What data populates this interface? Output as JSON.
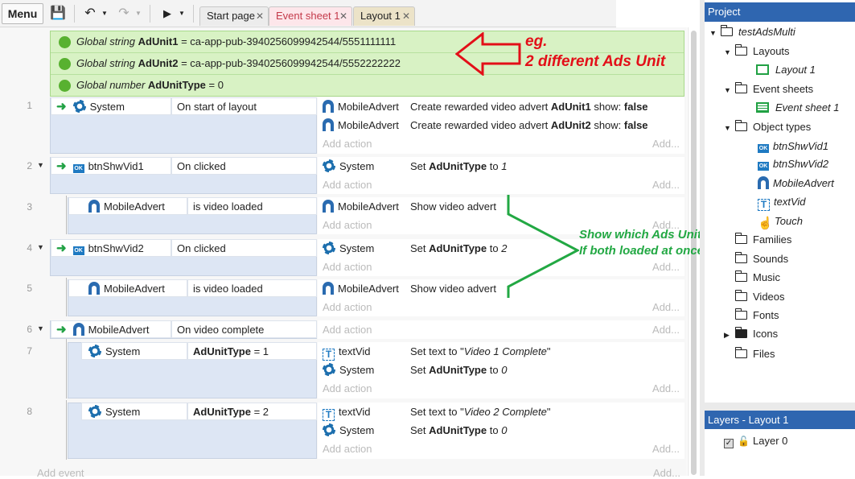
{
  "toolbar": {
    "menu": "Menu",
    "tabs": [
      "Start page",
      "Event sheet 1",
      "Layout 1"
    ]
  },
  "globals": [
    {
      "kind": "Global string",
      "name": "AdUnit1",
      "value": "= ca-app-pub-3940256099942544/5551111111"
    },
    {
      "kind": "Global string",
      "name": "AdUnit2",
      "value": "= ca-app-pub-3940256099942544/5552222222"
    },
    {
      "kind": "Global number",
      "name": "AdUnitType",
      "value": "= 0"
    }
  ],
  "events": {
    "e1": {
      "num": "1",
      "obj": "System",
      "cond": "On start of layout",
      "a1o": "MobileAdvert",
      "a1": "Create rewarded video advert ",
      "a1b": "AdUnit1",
      "a1c": " show: ",
      "a1d": "false",
      "a2o": "MobileAdvert",
      "a2": "Create rewarded video advert ",
      "a2b": "AdUnit2",
      "a2c": " show: ",
      "a2d": "false"
    },
    "e2": {
      "num": "2",
      "obj": "btnShwVid1",
      "cond": "On clicked",
      "ao": "System",
      "a": "Set ",
      "ab": "AdUnitType",
      "ac": " to ",
      "ad": "1"
    },
    "e3": {
      "num": "3",
      "obj": "MobileAdvert",
      "cond": "is video loaded",
      "ao": "MobileAdvert",
      "a": "Show video advert"
    },
    "e4": {
      "num": "4",
      "obj": "btnShwVid2",
      "cond": "On clicked",
      "ao": "System",
      "a": "Set ",
      "ab": "AdUnitType",
      "ac": " to ",
      "ad": "2"
    },
    "e5": {
      "num": "5",
      "obj": "MobileAdvert",
      "cond": "is video loaded",
      "ao": "MobileAdvert",
      "a": "Show video advert"
    },
    "e6": {
      "num": "6",
      "obj": "MobileAdvert",
      "cond": "On video complete"
    },
    "e7": {
      "num": "7",
      "obj": "System",
      "condb": "AdUnitType",
      "condc": " = 1",
      "a1o": "textVid",
      "a1": "Set text to \"",
      "a1i": "Video 1 Complete",
      "a1e": "\"",
      "a2o": "System",
      "a2": "Set ",
      "a2b": "AdUnitType",
      "a2c": " to ",
      "a2d": "0"
    },
    "e8": {
      "num": "8",
      "obj": "System",
      "condb": "AdUnitType",
      "condc": " = 2",
      "a1o": "textVid",
      "a1": "Set text to \"",
      "a1i": "Video 2 Complete",
      "a1e": "\"",
      "a2o": "System",
      "a2": "Set ",
      "a2b": "AdUnitType",
      "a2c": " to ",
      "a2d": "0"
    }
  },
  "add_action": "Add action",
  "add_dots": "Add...",
  "add_event": "Add event",
  "annotations": {
    "red1": "eg.",
    "red2": "2 different Ads Unit",
    "green1": "Show which Ads Unit",
    "green2": "If both loaded at once"
  },
  "project": {
    "header": "Project",
    "root": "testAdsMulti",
    "layouts": "Layouts",
    "layout1": "Layout 1",
    "eventsheets": "Event sheets",
    "eventsheet1": "Event sheet 1",
    "objecttypes": "Object types",
    "objects": [
      "btnShwVid1",
      "btnShwVid2",
      "MobileAdvert",
      "textVid",
      "Touch"
    ],
    "families": "Families",
    "sounds": "Sounds",
    "music": "Music",
    "videos": "Videos",
    "fonts": "Fonts",
    "icons": "Icons",
    "files": "Files"
  },
  "layers": {
    "header": "Layers - Layout 1",
    "layer0": "Layer 0"
  },
  "colors": {
    "accent": "#2f66b0",
    "globals_bg": "#d8f2c4",
    "annotation_red": "#e30f18",
    "annotation_green": "#22a843"
  }
}
